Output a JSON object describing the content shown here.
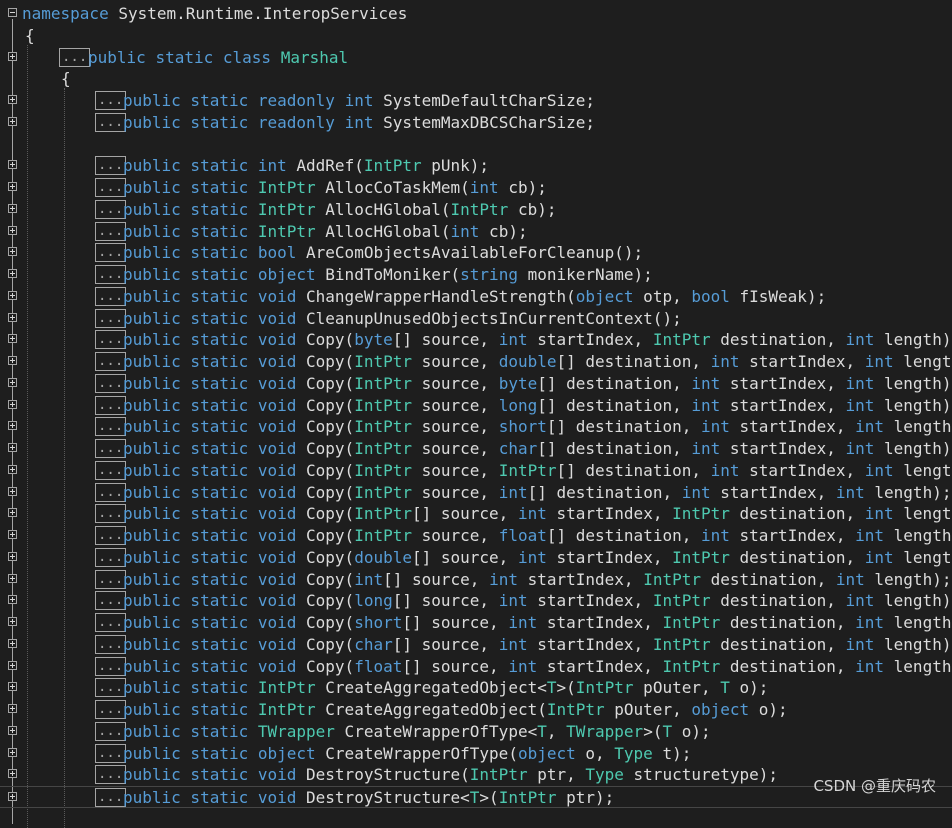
{
  "editor": {
    "namespace_line": [
      {
        "t": "namespace",
        "c": "kw"
      },
      {
        "t": " System.Runtime.InteropServices",
        "c": "tx"
      }
    ],
    "open_brace_outer": "{",
    "class_line": [
      {
        "t": "public",
        "c": "kw"
      },
      {
        "t": " ",
        "c": "tx"
      },
      {
        "t": "static",
        "c": "kw"
      },
      {
        "t": " ",
        "c": "tx"
      },
      {
        "t": "class",
        "c": "kw"
      },
      {
        "t": " ",
        "c": "tx"
      },
      {
        "t": "Marshal",
        "c": "ty"
      }
    ],
    "open_brace_inner": "{",
    "collapsed_label": "...",
    "members": [
      [
        {
          "t": "public static readonly ",
          "c": "kw"
        },
        {
          "t": "int",
          "c": "kw"
        },
        {
          "t": " SystemDefaultCharSize;",
          "c": "tx"
        }
      ],
      [
        {
          "t": "public static readonly ",
          "c": "kw"
        },
        {
          "t": "int",
          "c": "kw"
        },
        {
          "t": " SystemMaxDBCSCharSize;",
          "c": "tx"
        }
      ],
      null,
      [
        {
          "t": "public static ",
          "c": "kw"
        },
        {
          "t": "int",
          "c": "kw"
        },
        {
          "t": " AddRef(",
          "c": "tx"
        },
        {
          "t": "IntPtr",
          "c": "ty"
        },
        {
          "t": " pUnk);",
          "c": "tx"
        }
      ],
      [
        {
          "t": "public static ",
          "c": "kw"
        },
        {
          "t": "IntPtr",
          "c": "ty"
        },
        {
          "t": " AllocCoTaskMem(",
          "c": "tx"
        },
        {
          "t": "int",
          "c": "kw"
        },
        {
          "t": " cb);",
          "c": "tx"
        }
      ],
      [
        {
          "t": "public static ",
          "c": "kw"
        },
        {
          "t": "IntPtr",
          "c": "ty"
        },
        {
          "t": " AllocHGlobal(",
          "c": "tx"
        },
        {
          "t": "IntPtr",
          "c": "ty"
        },
        {
          "t": " cb);",
          "c": "tx"
        }
      ],
      [
        {
          "t": "public static ",
          "c": "kw"
        },
        {
          "t": "IntPtr",
          "c": "ty"
        },
        {
          "t": " AllocHGlobal(",
          "c": "tx"
        },
        {
          "t": "int",
          "c": "kw"
        },
        {
          "t": " cb);",
          "c": "tx"
        }
      ],
      [
        {
          "t": "public static ",
          "c": "kw"
        },
        {
          "t": "bool",
          "c": "kw"
        },
        {
          "t": " AreComObjectsAvailableForCleanup();",
          "c": "tx"
        }
      ],
      [
        {
          "t": "public static ",
          "c": "kw"
        },
        {
          "t": "object",
          "c": "kw"
        },
        {
          "t": " BindToMoniker(",
          "c": "tx"
        },
        {
          "t": "string",
          "c": "kw"
        },
        {
          "t": " monikerName);",
          "c": "tx"
        }
      ],
      [
        {
          "t": "public static ",
          "c": "kw"
        },
        {
          "t": "void",
          "c": "kw"
        },
        {
          "t": " ChangeWrapperHandleStrength(",
          "c": "tx"
        },
        {
          "t": "object",
          "c": "kw"
        },
        {
          "t": " otp, ",
          "c": "tx"
        },
        {
          "t": "bool",
          "c": "kw"
        },
        {
          "t": " fIsWeak);",
          "c": "tx"
        }
      ],
      [
        {
          "t": "public static ",
          "c": "kw"
        },
        {
          "t": "void",
          "c": "kw"
        },
        {
          "t": " CleanupUnusedObjectsInCurrentContext();",
          "c": "tx"
        }
      ],
      [
        {
          "t": "public static ",
          "c": "kw"
        },
        {
          "t": "void",
          "c": "kw"
        },
        {
          "t": " Copy(",
          "c": "tx"
        },
        {
          "t": "byte",
          "c": "kw"
        },
        {
          "t": "[] source, ",
          "c": "tx"
        },
        {
          "t": "int",
          "c": "kw"
        },
        {
          "t": " startIndex, ",
          "c": "tx"
        },
        {
          "t": "IntPtr",
          "c": "ty"
        },
        {
          "t": " destination, ",
          "c": "tx"
        },
        {
          "t": "int",
          "c": "kw"
        },
        {
          "t": " length);",
          "c": "tx"
        }
      ],
      [
        {
          "t": "public static ",
          "c": "kw"
        },
        {
          "t": "void",
          "c": "kw"
        },
        {
          "t": " Copy(",
          "c": "tx"
        },
        {
          "t": "IntPtr",
          "c": "ty"
        },
        {
          "t": " source, ",
          "c": "tx"
        },
        {
          "t": "double",
          "c": "kw"
        },
        {
          "t": "[] destination, ",
          "c": "tx"
        },
        {
          "t": "int",
          "c": "kw"
        },
        {
          "t": " startIndex, ",
          "c": "tx"
        },
        {
          "t": "int",
          "c": "kw"
        },
        {
          "t": " length);",
          "c": "tx"
        }
      ],
      [
        {
          "t": "public static ",
          "c": "kw"
        },
        {
          "t": "void",
          "c": "kw"
        },
        {
          "t": " Copy(",
          "c": "tx"
        },
        {
          "t": "IntPtr",
          "c": "ty"
        },
        {
          "t": " source, ",
          "c": "tx"
        },
        {
          "t": "byte",
          "c": "kw"
        },
        {
          "t": "[] destination, ",
          "c": "tx"
        },
        {
          "t": "int",
          "c": "kw"
        },
        {
          "t": " startIndex, ",
          "c": "tx"
        },
        {
          "t": "int",
          "c": "kw"
        },
        {
          "t": " length);",
          "c": "tx"
        }
      ],
      [
        {
          "t": "public static ",
          "c": "kw"
        },
        {
          "t": "void",
          "c": "kw"
        },
        {
          "t": " Copy(",
          "c": "tx"
        },
        {
          "t": "IntPtr",
          "c": "ty"
        },
        {
          "t": " source, ",
          "c": "tx"
        },
        {
          "t": "long",
          "c": "kw"
        },
        {
          "t": "[] destination, ",
          "c": "tx"
        },
        {
          "t": "int",
          "c": "kw"
        },
        {
          "t": " startIndex, ",
          "c": "tx"
        },
        {
          "t": "int",
          "c": "kw"
        },
        {
          "t": " length);",
          "c": "tx"
        }
      ],
      [
        {
          "t": "public static ",
          "c": "kw"
        },
        {
          "t": "void",
          "c": "kw"
        },
        {
          "t": " Copy(",
          "c": "tx"
        },
        {
          "t": "IntPtr",
          "c": "ty"
        },
        {
          "t": " source, ",
          "c": "tx"
        },
        {
          "t": "short",
          "c": "kw"
        },
        {
          "t": "[] destination, ",
          "c": "tx"
        },
        {
          "t": "int",
          "c": "kw"
        },
        {
          "t": " startIndex, ",
          "c": "tx"
        },
        {
          "t": "int",
          "c": "kw"
        },
        {
          "t": " length);",
          "c": "tx"
        }
      ],
      [
        {
          "t": "public static ",
          "c": "kw"
        },
        {
          "t": "void",
          "c": "kw"
        },
        {
          "t": " Copy(",
          "c": "tx"
        },
        {
          "t": "IntPtr",
          "c": "ty"
        },
        {
          "t": " source, ",
          "c": "tx"
        },
        {
          "t": "char",
          "c": "kw"
        },
        {
          "t": "[] destination, ",
          "c": "tx"
        },
        {
          "t": "int",
          "c": "kw"
        },
        {
          "t": " startIndex, ",
          "c": "tx"
        },
        {
          "t": "int",
          "c": "kw"
        },
        {
          "t": " length);",
          "c": "tx"
        }
      ],
      [
        {
          "t": "public static ",
          "c": "kw"
        },
        {
          "t": "void",
          "c": "kw"
        },
        {
          "t": " Copy(",
          "c": "tx"
        },
        {
          "t": "IntPtr",
          "c": "ty"
        },
        {
          "t": " source, ",
          "c": "tx"
        },
        {
          "t": "IntPtr",
          "c": "ty"
        },
        {
          "t": "[] destination, ",
          "c": "tx"
        },
        {
          "t": "int",
          "c": "kw"
        },
        {
          "t": " startIndex, ",
          "c": "tx"
        },
        {
          "t": "int",
          "c": "kw"
        },
        {
          "t": " length);",
          "c": "tx"
        }
      ],
      [
        {
          "t": "public static ",
          "c": "kw"
        },
        {
          "t": "void",
          "c": "kw"
        },
        {
          "t": " Copy(",
          "c": "tx"
        },
        {
          "t": "IntPtr",
          "c": "ty"
        },
        {
          "t": " source, ",
          "c": "tx"
        },
        {
          "t": "int",
          "c": "kw"
        },
        {
          "t": "[] destination, ",
          "c": "tx"
        },
        {
          "t": "int",
          "c": "kw"
        },
        {
          "t": " startIndex, ",
          "c": "tx"
        },
        {
          "t": "int",
          "c": "kw"
        },
        {
          "t": " length);",
          "c": "tx"
        }
      ],
      [
        {
          "t": "public static ",
          "c": "kw"
        },
        {
          "t": "void",
          "c": "kw"
        },
        {
          "t": " Copy(",
          "c": "tx"
        },
        {
          "t": "IntPtr",
          "c": "ty"
        },
        {
          "t": "[] source, ",
          "c": "tx"
        },
        {
          "t": "int",
          "c": "kw"
        },
        {
          "t": " startIndex, ",
          "c": "tx"
        },
        {
          "t": "IntPtr",
          "c": "ty"
        },
        {
          "t": " destination, ",
          "c": "tx"
        },
        {
          "t": "int",
          "c": "kw"
        },
        {
          "t": " length);",
          "c": "tx"
        }
      ],
      [
        {
          "t": "public static ",
          "c": "kw"
        },
        {
          "t": "void",
          "c": "kw"
        },
        {
          "t": " Copy(",
          "c": "tx"
        },
        {
          "t": "IntPtr",
          "c": "ty"
        },
        {
          "t": " source, ",
          "c": "tx"
        },
        {
          "t": "float",
          "c": "kw"
        },
        {
          "t": "[] destination, ",
          "c": "tx"
        },
        {
          "t": "int",
          "c": "kw"
        },
        {
          "t": " startIndex, ",
          "c": "tx"
        },
        {
          "t": "int",
          "c": "kw"
        },
        {
          "t": " length);",
          "c": "tx"
        }
      ],
      [
        {
          "t": "public static ",
          "c": "kw"
        },
        {
          "t": "void",
          "c": "kw"
        },
        {
          "t": " Copy(",
          "c": "tx"
        },
        {
          "t": "double",
          "c": "kw"
        },
        {
          "t": "[] source, ",
          "c": "tx"
        },
        {
          "t": "int",
          "c": "kw"
        },
        {
          "t": " startIndex, ",
          "c": "tx"
        },
        {
          "t": "IntPtr",
          "c": "ty"
        },
        {
          "t": " destination, ",
          "c": "tx"
        },
        {
          "t": "int",
          "c": "kw"
        },
        {
          "t": " length);",
          "c": "tx"
        }
      ],
      [
        {
          "t": "public static ",
          "c": "kw"
        },
        {
          "t": "void",
          "c": "kw"
        },
        {
          "t": " Copy(",
          "c": "tx"
        },
        {
          "t": "int",
          "c": "kw"
        },
        {
          "t": "[] source, ",
          "c": "tx"
        },
        {
          "t": "int",
          "c": "kw"
        },
        {
          "t": " startIndex, ",
          "c": "tx"
        },
        {
          "t": "IntPtr",
          "c": "ty"
        },
        {
          "t": " destination, ",
          "c": "tx"
        },
        {
          "t": "int",
          "c": "kw"
        },
        {
          "t": " length);",
          "c": "tx"
        }
      ],
      [
        {
          "t": "public static ",
          "c": "kw"
        },
        {
          "t": "void",
          "c": "kw"
        },
        {
          "t": " Copy(",
          "c": "tx"
        },
        {
          "t": "long",
          "c": "kw"
        },
        {
          "t": "[] source, ",
          "c": "tx"
        },
        {
          "t": "int",
          "c": "kw"
        },
        {
          "t": " startIndex, ",
          "c": "tx"
        },
        {
          "t": "IntPtr",
          "c": "ty"
        },
        {
          "t": " destination, ",
          "c": "tx"
        },
        {
          "t": "int",
          "c": "kw"
        },
        {
          "t": " length);",
          "c": "tx"
        }
      ],
      [
        {
          "t": "public static ",
          "c": "kw"
        },
        {
          "t": "void",
          "c": "kw"
        },
        {
          "t": " Copy(",
          "c": "tx"
        },
        {
          "t": "short",
          "c": "kw"
        },
        {
          "t": "[] source, ",
          "c": "tx"
        },
        {
          "t": "int",
          "c": "kw"
        },
        {
          "t": " startIndex, ",
          "c": "tx"
        },
        {
          "t": "IntPtr",
          "c": "ty"
        },
        {
          "t": " destination, ",
          "c": "tx"
        },
        {
          "t": "int",
          "c": "kw"
        },
        {
          "t": " length);",
          "c": "tx"
        }
      ],
      [
        {
          "t": "public static ",
          "c": "kw"
        },
        {
          "t": "void",
          "c": "kw"
        },
        {
          "t": " Copy(",
          "c": "tx"
        },
        {
          "t": "char",
          "c": "kw"
        },
        {
          "t": "[] source, ",
          "c": "tx"
        },
        {
          "t": "int",
          "c": "kw"
        },
        {
          "t": " startIndex, ",
          "c": "tx"
        },
        {
          "t": "IntPtr",
          "c": "ty"
        },
        {
          "t": " destination, ",
          "c": "tx"
        },
        {
          "t": "int",
          "c": "kw"
        },
        {
          "t": " length);",
          "c": "tx"
        }
      ],
      [
        {
          "t": "public static ",
          "c": "kw"
        },
        {
          "t": "void",
          "c": "kw"
        },
        {
          "t": " Copy(",
          "c": "tx"
        },
        {
          "t": "float",
          "c": "kw"
        },
        {
          "t": "[] source, ",
          "c": "tx"
        },
        {
          "t": "int",
          "c": "kw"
        },
        {
          "t": " startIndex, ",
          "c": "tx"
        },
        {
          "t": "IntPtr",
          "c": "ty"
        },
        {
          "t": " destination, ",
          "c": "tx"
        },
        {
          "t": "int",
          "c": "kw"
        },
        {
          "t": " length);",
          "c": "tx"
        }
      ],
      [
        {
          "t": "public static ",
          "c": "kw"
        },
        {
          "t": "IntPtr",
          "c": "ty"
        },
        {
          "t": " CreateAggregatedObject<",
          "c": "tx"
        },
        {
          "t": "T",
          "c": "ty"
        },
        {
          "t": ">(",
          "c": "tx"
        },
        {
          "t": "IntPtr",
          "c": "ty"
        },
        {
          "t": " pOuter, ",
          "c": "tx"
        },
        {
          "t": "T",
          "c": "ty"
        },
        {
          "t": " o);",
          "c": "tx"
        }
      ],
      [
        {
          "t": "public static ",
          "c": "kw"
        },
        {
          "t": "IntPtr",
          "c": "ty"
        },
        {
          "t": " CreateAggregatedObject(",
          "c": "tx"
        },
        {
          "t": "IntPtr",
          "c": "ty"
        },
        {
          "t": " pOuter, ",
          "c": "tx"
        },
        {
          "t": "object",
          "c": "kw"
        },
        {
          "t": " o);",
          "c": "tx"
        }
      ],
      [
        {
          "t": "public static ",
          "c": "kw"
        },
        {
          "t": "TWrapper",
          "c": "ty"
        },
        {
          "t": " CreateWrapperOfType<",
          "c": "tx"
        },
        {
          "t": "T",
          "c": "ty"
        },
        {
          "t": ", ",
          "c": "tx"
        },
        {
          "t": "TWrapper",
          "c": "ty"
        },
        {
          "t": ">(",
          "c": "tx"
        },
        {
          "t": "T",
          "c": "ty"
        },
        {
          "t": " o);",
          "c": "tx"
        }
      ],
      [
        {
          "t": "public static ",
          "c": "kw"
        },
        {
          "t": "object",
          "c": "kw"
        },
        {
          "t": " CreateWrapperOfType(",
          "c": "tx"
        },
        {
          "t": "object",
          "c": "kw"
        },
        {
          "t": " o, ",
          "c": "tx"
        },
        {
          "t": "Type",
          "c": "ty"
        },
        {
          "t": " t);",
          "c": "tx"
        }
      ],
      [
        {
          "t": "public static ",
          "c": "kw"
        },
        {
          "t": "void",
          "c": "kw"
        },
        {
          "t": " DestroyStructure(",
          "c": "tx"
        },
        {
          "t": "IntPtr",
          "c": "ty"
        },
        {
          "t": " ptr, ",
          "c": "tx"
        },
        {
          "t": "Type",
          "c": "ty"
        },
        {
          "t": " structuretype);",
          "c": "tx"
        }
      ],
      [
        {
          "t": "public static ",
          "c": "kw"
        },
        {
          "t": "void",
          "c": "kw"
        },
        {
          "t": " DestroyStructure<",
          "c": "tx"
        },
        {
          "t": "T",
          "c": "ty"
        },
        {
          "t": ">(",
          "c": "tx"
        },
        {
          "t": "IntPtr",
          "c": "ty"
        },
        {
          "t": " ptr);",
          "c": "tx"
        }
      ]
    ],
    "highlighted_member_index": 32
  },
  "watermark": "CSDN @重庆码农",
  "colors": {
    "background": "#1e1e1e",
    "keyword": "#569cd6",
    "type": "#4ec9b0",
    "text": "#dcdcdc",
    "outline": "#a5a5a5"
  }
}
